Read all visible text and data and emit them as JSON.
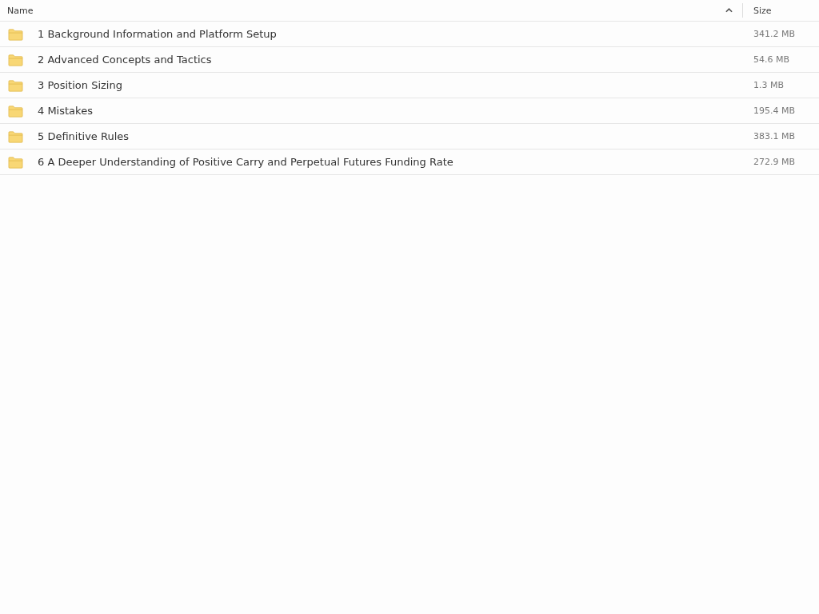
{
  "table": {
    "columns": [
      {
        "label": "Name",
        "sorted": true
      },
      {
        "label": "Size",
        "sorted": false
      }
    ],
    "rows": [
      {
        "name": "1 Background Information and Platform Setup",
        "size": "341.2 MB"
      },
      {
        "name": "2 Advanced Concepts and Tactics",
        "size": "54.6 MB"
      },
      {
        "name": "3 Position Sizing",
        "size": "1.3 MB"
      },
      {
        "name": "4 Mistakes",
        "size": "195.4 MB"
      },
      {
        "name": "5 Definitive Rules",
        "size": "383.1 MB"
      },
      {
        "name": "6 A Deeper Understanding of Positive Carry and Perpetual Futures Funding Rate",
        "size": "272.9 MB"
      }
    ]
  }
}
